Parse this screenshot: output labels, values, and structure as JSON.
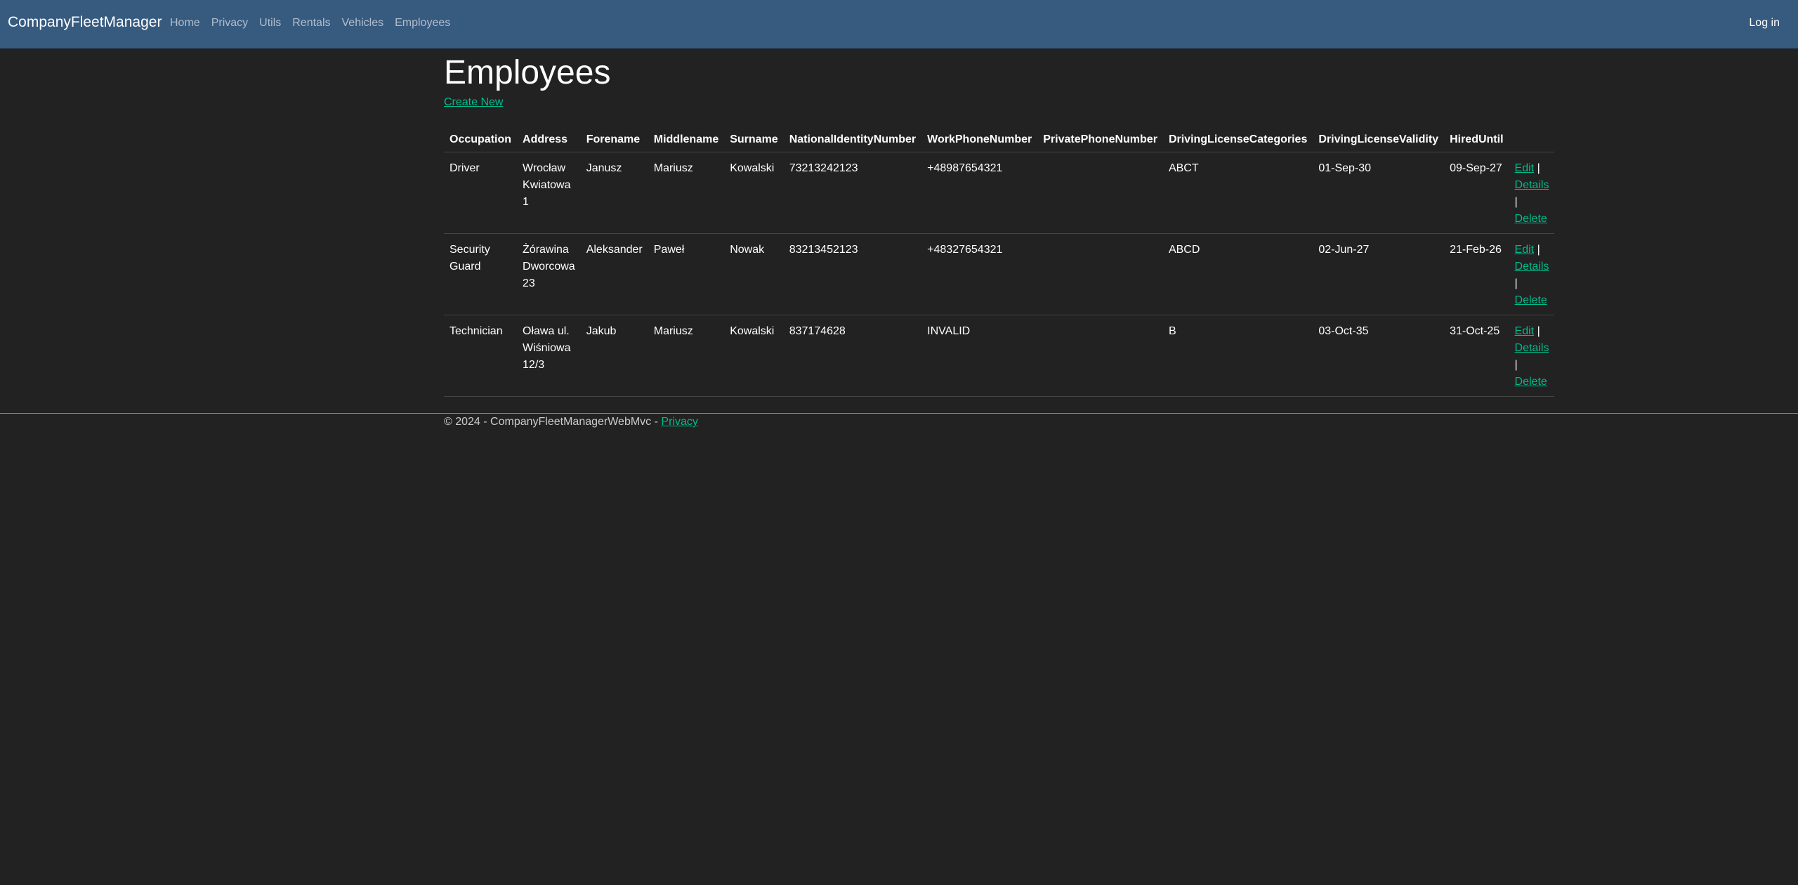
{
  "navbar": {
    "brand": "CompanyFleetManager",
    "links": [
      "Home",
      "Privacy",
      "Utils",
      "Rentals",
      "Vehicles",
      "Employees"
    ],
    "login": "Log in"
  },
  "page": {
    "title": "Employees",
    "create_link": "Create New"
  },
  "table": {
    "headers": [
      "Occupation",
      "Address",
      "Forename",
      "Middlename",
      "Surname",
      "NationalIdentityNumber",
      "WorkPhoneNumber",
      "PrivatePhoneNumber",
      "DrivingLicenseCategories",
      "DrivingLicenseValidity",
      "HiredUntil"
    ],
    "rows": [
      {
        "occupation": "Driver",
        "address": "Wrocław Kwiatowa 1",
        "forename": "Janusz",
        "middlename": "Mariusz",
        "surname": "Kowalski",
        "nin": "73213242123",
        "work_phone": "+48987654321",
        "private_phone": "",
        "license_categories": "ABCT",
        "license_validity": "01-Sep-30",
        "hired_until": "09-Sep-27"
      },
      {
        "occupation": "Security Guard",
        "address": "Żórawina Dworcowa 23",
        "forename": "Aleksander",
        "middlename": "Paweł",
        "surname": "Nowak",
        "nin": "83213452123",
        "work_phone": "+48327654321",
        "private_phone": "",
        "license_categories": "ABCD",
        "license_validity": "02-Jun-27",
        "hired_until": "21-Feb-26"
      },
      {
        "occupation": "Technician",
        "address": "Oława ul. Wiśniowa 12/3",
        "forename": "Jakub",
        "middlename": "Mariusz",
        "surname": "Kowalski",
        "nin": "837174628",
        "work_phone": "INVALID",
        "private_phone": "",
        "license_categories": "B",
        "license_validity": "03-Oct-35",
        "hired_until": "31-Oct-25"
      }
    ],
    "actions": {
      "edit": "Edit",
      "details": "Details",
      "delete": "Delete",
      "separator": "|"
    }
  },
  "footer": {
    "text": "© 2024 - CompanyFleetManagerWebMvc - ",
    "privacy": "Privacy"
  },
  "colors": {
    "navbar": "#375a7f",
    "background": "#222222",
    "link": "#00bc8c"
  }
}
